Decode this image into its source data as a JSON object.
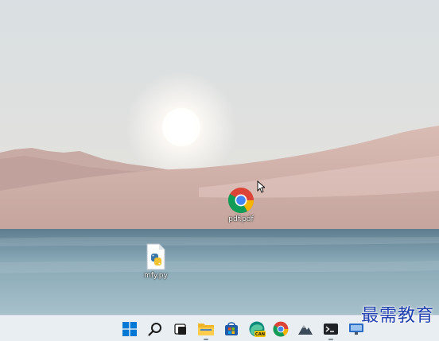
{
  "desktop": {
    "icons": [
      {
        "label": "pdf.pdf",
        "icon": "chrome-icon"
      },
      {
        "label": "mfy.py",
        "icon": "python-file-icon"
      }
    ]
  },
  "taskbar": {
    "items": [
      {
        "name": "start-button",
        "icon": "windows-icon"
      },
      {
        "name": "search-button",
        "icon": "search-icon"
      },
      {
        "name": "task-view-button",
        "icon": "task-view-icon"
      },
      {
        "name": "file-explorer-button",
        "icon": "folder-icon"
      },
      {
        "name": "store-button",
        "icon": "store-icon"
      },
      {
        "name": "edge-canary-button",
        "icon": "edge-canary-icon",
        "badge": "CAN"
      },
      {
        "name": "chrome-button",
        "icon": "chrome-icon"
      },
      {
        "name": "photos-button",
        "icon": "mountain-icon"
      },
      {
        "name": "terminal-button",
        "icon": "terminal-icon"
      },
      {
        "name": "remote-desktop-button",
        "icon": "monitor-icon"
      }
    ]
  },
  "watermark": {
    "text": "最需教育"
  },
  "colors": {
    "accent": "#0078d4",
    "watermark": "#1f3fae"
  }
}
